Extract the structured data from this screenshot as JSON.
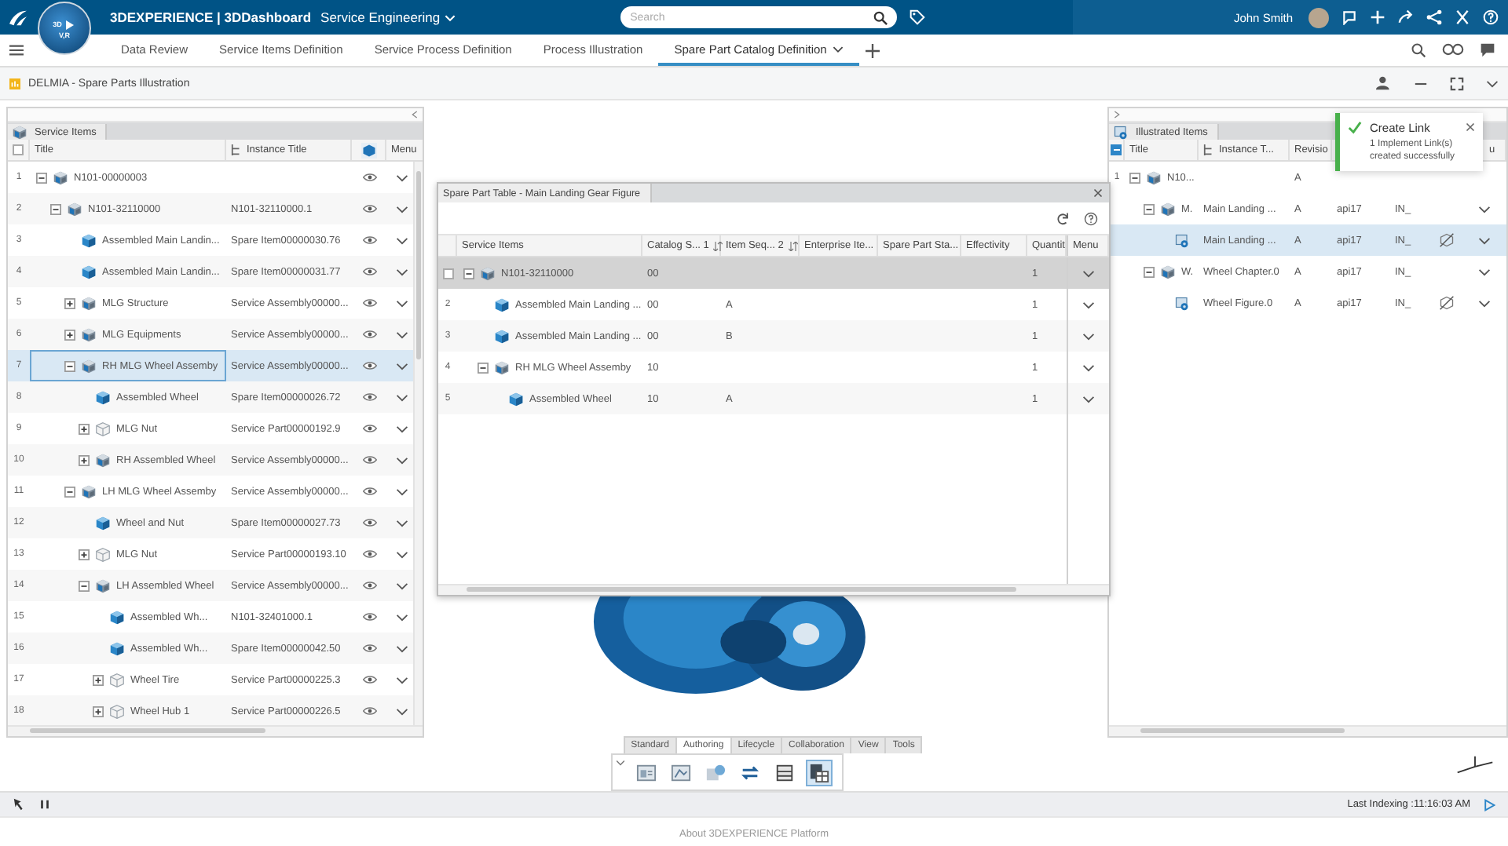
{
  "top_bar": {
    "compass_labels": [
      "3D",
      "V,R"
    ],
    "brand": "3DEXPERIENCE | 3DDashboard",
    "dashboard": "Service Engineering",
    "search": {
      "placeholder": "Search"
    },
    "user": "John Smith"
  },
  "tabs": [
    {
      "label": "Data Review",
      "selected": false
    },
    {
      "label": "Service Items Definition",
      "selected": false
    },
    {
      "label": "Service Process Definition",
      "selected": false
    },
    {
      "label": "Process Illustration",
      "selected": false
    },
    {
      "label": "Spare Part Catalog Definition",
      "selected": true
    }
  ],
  "app": {
    "title": "DELMIA - Spare Parts Illustration"
  },
  "service_items": {
    "tab": "Service Items",
    "header_partial": false,
    "columns": [
      "Title",
      "Instance Title",
      "Menu"
    ],
    "rows": [
      {
        "number": "1",
        "title": "N101-00000003",
        "kind": "assembly",
        "expanded": true,
        "selected": false,
        "children": [
          {
            "number": "2",
            "title": "N101-32110000",
            "instance": "N101-32110000.1",
            "kind": "assembly",
            "expanded": true,
            "selected": false,
            "children": [
              {
                "number": "3",
                "title": "Assembled Main Landin...",
                "instance": "Spare Item00000030.76",
                "kind": "spare",
                "selected": false
              },
              {
                "number": "4",
                "title": "Assembled Main Landin...",
                "instance": "Spare Item00000031.77",
                "kind": "spare",
                "selected": false
              },
              {
                "number": "5",
                "title": "MLG Structure",
                "instance": "Service Assembly00000...",
                "kind": "assembly",
                "expanded": false,
                "selected": false
              },
              {
                "number": "6",
                "title": "MLG Equipments",
                "instance": "Service Assembly00000...",
                "kind": "assembly",
                "expanded": false,
                "selected": false
              },
              {
                "number": "7",
                "title": "RH MLG Wheel Assemby",
                "instance": "Service Assembly00000...",
                "kind": "assembly",
                "expanded": true,
                "selected": true,
                "children": [
                  {
                    "number": "8",
                    "title": "Assembled Wheel",
                    "instance": "Spare Item00000026.72",
                    "kind": "spare",
                    "selected": false
                  },
                  {
                    "number": "9",
                    "title": "MLG Nut",
                    "instance": "Service Part00000192.9",
                    "kind": "part",
                    "expanded": false,
                    "selected": false
                  },
                  {
                    "number": "10",
                    "title": "RH Assembled Wheel",
                    "instance": "Service Assembly00000...",
                    "kind": "assembly",
                    "expanded": false,
                    "selected": false
                  }
                ]
              },
              {
                "number": "11",
                "title": "LH MLG Wheel Assemby",
                "instance": "Service Assembly00000...",
                "kind": "assembly",
                "expanded": true,
                "selected": false,
                "children": [
                  {
                    "number": "12",
                    "title": "Wheel and Nut",
                    "instance": "Spare Item00000027.73",
                    "kind": "spare",
                    "selected": false
                  },
                  {
                    "number": "13",
                    "title": "MLG Nut",
                    "instance": "Service Part00000193.10",
                    "kind": "part",
                    "expanded": false,
                    "selected": false
                  },
                  {
                    "number": "14",
                    "title": "LH Assembled Wheel",
                    "instance": "Service Assembly00000...",
                    "kind": "assembly",
                    "expanded": true,
                    "selected": false,
                    "children": [
                      {
                        "number": "15",
                        "title": "Assembled Wh...",
                        "instance": "N101-32401000.1",
                        "kind": "spare",
                        "selected": false
                      },
                      {
                        "number": "16",
                        "title": "Assembled Wh...",
                        "instance": "Spare Item00000042.50",
                        "kind": "spare",
                        "selected": false
                      },
                      {
                        "number": "17",
                        "title": "Wheel Tire",
                        "instance": "Service Part00000225.3",
                        "kind": "part",
                        "expanded": false,
                        "selected": false
                      },
                      {
                        "number": "18",
                        "title": "Wheel Hub 1",
                        "instance": "Service Part00000226.5",
                        "kind": "part",
                        "expanded": false,
                        "selected": false
                      }
                    ]
                  }
                ]
              }
            ]
          }
        ]
      }
    ]
  },
  "spare_part_table": {
    "title": "Spare Part Table - Main Landing Gear Figure",
    "columns": [
      {
        "label": "Service Items"
      },
      {
        "label": "Catalog S...",
        "sort_index": "1"
      },
      {
        "label": "Item Seq...",
        "sort_index": "2"
      },
      {
        "label": "Enterprise Ite..."
      },
      {
        "label": "Spare Part Sta..."
      },
      {
        "label": "Effectivity"
      },
      {
        "label": "Quantit"
      },
      {
        "label": "Menu"
      }
    ],
    "rows": [
      {
        "title": "N101-32110000",
        "catalog": "00",
        "quantity": "1",
        "kind": "assembly",
        "expanded": true,
        "selected": true,
        "children": [
          {
            "number": "2",
            "title": "Assembled Main Landing ...",
            "catalog": "00",
            "item_seq": "A",
            "quantity": "1",
            "kind": "spare",
            "selected": false
          },
          {
            "number": "3",
            "title": "Assembled Main Landing ...",
            "catalog": "00",
            "item_seq": "B",
            "quantity": "1",
            "kind": "spare",
            "selected": false
          },
          {
            "number": "4",
            "title": "RH MLG Wheel Assemby",
            "catalog": "10",
            "quantity": "1",
            "kind": "assembly",
            "expanded": true,
            "selected": false,
            "children": [
              {
                "number": "5",
                "title": "Assembled Wheel",
                "catalog": "10",
                "item_seq": "A",
                "quantity": "1",
                "kind": "spare",
                "selected": false
              }
            ]
          }
        ]
      }
    ]
  },
  "illustrated_items": {
    "tab": "Illustrated Items",
    "header_partial": true,
    "columns": [
      "Title",
      "Instance T...",
      "Revisio",
      "u"
    ],
    "rows": [
      {
        "number": "1",
        "title": "N10...",
        "revision": "A",
        "kind": "assembly",
        "expanded": true,
        "selected": false,
        "children": [
          {
            "title": "M.",
            "instance": "Main Landing ...",
            "revision": "A",
            "column_4": "api17",
            "column_5": "IN_",
            "kind": "assembly",
            "linked": false,
            "expanded": true,
            "selected": false,
            "children": [
              {
                "instance": "Main Landing ...",
                "revision": "A",
                "column_4": "api17",
                "column_5": "IN_",
                "kind": "figure",
                "linked": true,
                "selected": true
              }
            ]
          },
          {
            "title": "W.",
            "instance": "Wheel Chapter.0",
            "revision": "A",
            "column_4": "api17",
            "column_5": "IN_",
            "kind": "assembly",
            "linked": false,
            "expanded": true,
            "selected": false,
            "children": [
              {
                "instance": "Wheel Figure.0",
                "revision": "A",
                "column_4": "api17",
                "column_5": "IN_",
                "kind": "figure",
                "linked": true,
                "selected": false
              }
            ]
          }
        ]
      }
    ]
  },
  "toast": {
    "title": "Create Link",
    "message": "1 Implement Link(s) created successfully"
  },
  "ribbon": {
    "tabs": [
      {
        "label": "Standard",
        "selected": false
      },
      {
        "label": "Authoring",
        "selected": true
      },
      {
        "label": "Lifecycle",
        "selected": false
      },
      {
        "label": "Collaboration",
        "selected": false
      },
      {
        "label": "View",
        "selected": false
      },
      {
        "label": "Tools",
        "selected": false
      }
    ],
    "tools": [
      {
        "kind": "catalog",
        "selected": false
      },
      {
        "kind": "chapter",
        "selected": false
      },
      {
        "kind": "link",
        "selected": false
      },
      {
        "kind": "swap",
        "selected": false
      },
      {
        "kind": "panel",
        "selected": false
      },
      {
        "kind": "figure",
        "selected": true
      }
    ]
  },
  "status_bar": {
    "indexing": "Last Indexing :11:16:03 AM"
  },
  "footer": {
    "text": "About 3DEXPERIENCE Platform"
  }
}
